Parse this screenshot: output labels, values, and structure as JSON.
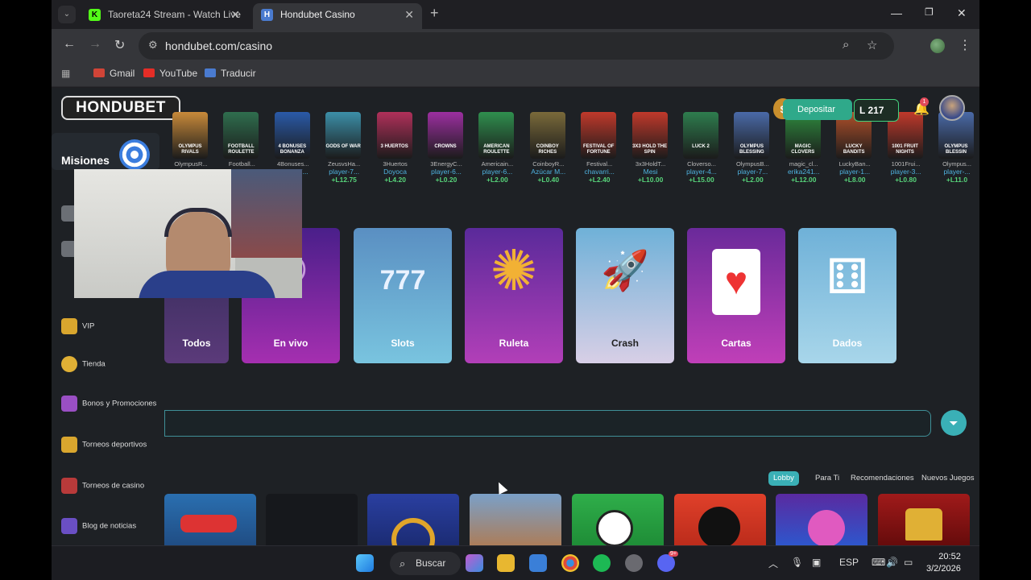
{
  "browser": {
    "tabs": [
      {
        "title": "Taoreta24 Stream - Watch Live",
        "icon": "K",
        "color": "#53fc18"
      },
      {
        "title": "Hondubet Casino",
        "icon": "H",
        "color": "#4a7bd0"
      }
    ],
    "url": "hondubet.com/casino",
    "bookmarks": [
      "Gmail",
      "YouTube",
      "Traducir"
    ]
  },
  "site": {
    "logo": "HONDUBET",
    "deposit": "Depositar",
    "balance": "L 217",
    "notif_count": "1"
  },
  "recent_wins": [
    {
      "art": "OLYMPUS RIVALS",
      "game": "OlympusR...",
      "player": "",
      "amount": "",
      "color": "#c88a3a"
    },
    {
      "art": "FOOTBALL ROULETTE",
      "game": "Football...",
      "player": "",
      "amount": "",
      "color": "#2f6e4e"
    },
    {
      "art": "4 BONUSES BONANZA",
      "game": "4Bonuses...",
      "player": "player-7...",
      "amount": "+L",
      "color": "#2a5aa8"
    },
    {
      "art": "GODS OF WAR",
      "game": "ZeusvsHa...",
      "player": "player-7...",
      "amount": "+L12.75",
      "color": "#3c8fa8"
    },
    {
      "art": "3 HUERTOS",
      "game": "3Huertos",
      "player": "Doyoca",
      "amount": "+L4.20",
      "color": "#b0305a"
    },
    {
      "art": "CROWNS",
      "game": "3EnergyC...",
      "player": "player-6...",
      "amount": "+L0.20",
      "color": "#9c2fa0"
    },
    {
      "art": "AMERICAN ROULETTE",
      "game": "Americain...",
      "player": "player-6...",
      "amount": "+L2.00",
      "color": "#2f8f4e"
    },
    {
      "art": "COINBOY RICHES",
      "game": "CoinboyR...",
      "player": "Azúcar M...",
      "amount": "+L0.40",
      "color": "#7a6a3a"
    },
    {
      "art": "FESTIVAL OF FORTUNE",
      "game": "Festival...",
      "player": "chavarri...",
      "amount": "+L2.40",
      "color": "#c0392b"
    },
    {
      "art": "3X3 HOLD THE SPIN",
      "game": "3x3HoldT...",
      "player": "Mesi",
      "amount": "+L10.00",
      "color": "#c0392b"
    },
    {
      "art": "LUCK 2",
      "game": "Cloverso...",
      "player": "player-4...",
      "amount": "+L15.00",
      "color": "#2e7d4e"
    },
    {
      "art": "OLYMPUS BLESSING",
      "game": "OlympusB...",
      "player": "player-7...",
      "amount": "+L2.00",
      "color": "#4a6aa8"
    },
    {
      "art": "MAGIC CLOVERS",
      "game": "magic_cl...",
      "player": "erika241...",
      "amount": "+L12.00",
      "color": "#2e8a3e"
    },
    {
      "art": "LUCKY BANDITS",
      "game": "LuckyBan...",
      "player": "player-1...",
      "amount": "+L8.00",
      "color": "#b0502a"
    },
    {
      "art": "1001 FRUIT NIGHTS",
      "game": "1001Frui...",
      "player": "player-3...",
      "amount": "+L0.80",
      "color": "#c0392b"
    },
    {
      "art": "OLYMPUS BLESSIN",
      "game": "Olympus...",
      "player": "player-...",
      "amount": "+L11.0",
      "color": "#4a6aa8"
    }
  ],
  "sidebar": {
    "missions": "Misiones",
    "items": [
      {
        "label": "VIP",
        "icon": "crown-icon"
      },
      {
        "label": "Tienda",
        "icon": "coin-icon"
      },
      {
        "label": "Bonos y Promociones",
        "icon": "gift-icon"
      },
      {
        "label": "Torneos deportivos",
        "icon": "trophy-icon"
      },
      {
        "label": "Torneos de casino",
        "icon": "slot-icon"
      },
      {
        "label": "Blog de noticias",
        "icon": "news-icon"
      }
    ]
  },
  "categories": [
    {
      "label": "Todos",
      "art": "◎"
    },
    {
      "label": "En vivo",
      "art": "◉"
    },
    {
      "label": "Slots",
      "art": "777"
    },
    {
      "label": "Ruleta",
      "art": "✺"
    },
    {
      "label": "Crash",
      "art": "🚀"
    },
    {
      "label": "Cartas",
      "art": "♥"
    },
    {
      "label": "Dados",
      "art": "⚅"
    }
  ],
  "filters": [
    "Lobby",
    "Para Ti",
    "Recomendaciones",
    "Nuevos Juegos"
  ],
  "taskbar": {
    "search": "Buscar",
    "lang": "ESP",
    "time": "20:52",
    "date": "3/2/2026",
    "discord_badge": "9+"
  }
}
